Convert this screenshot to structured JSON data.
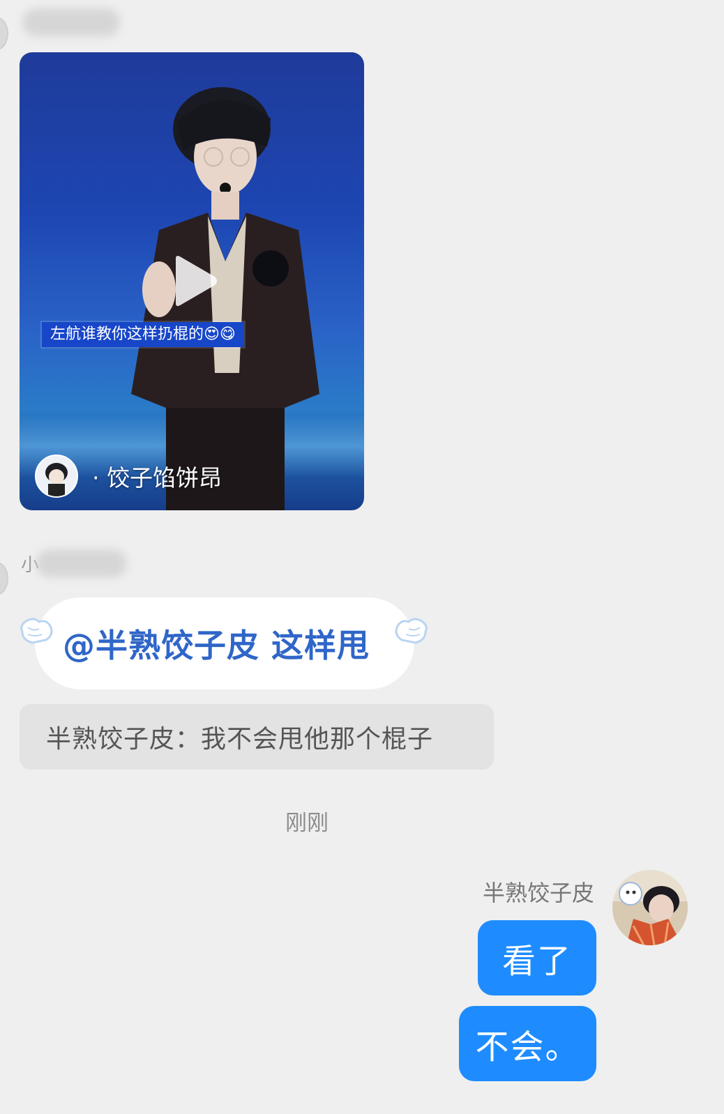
{
  "video_card": {
    "subtitle": "左航谁教你这样扔棍的😍😋",
    "author": "· 饺子馅饼昂",
    "play_icon": "play-icon"
  },
  "mention_message": {
    "mention": "@半熟饺子皮",
    "text": "这样甩"
  },
  "quote": {
    "text": "半熟饺子皮：我不会甩他那个棍子"
  },
  "timestamp": "刚刚",
  "self": {
    "name": "半熟饺子皮",
    "messages": [
      "看了",
      "不会。"
    ]
  },
  "colors": {
    "background": "#efefef",
    "self_bubble": "#1e8cff",
    "mention_text": "#2f66c8"
  }
}
